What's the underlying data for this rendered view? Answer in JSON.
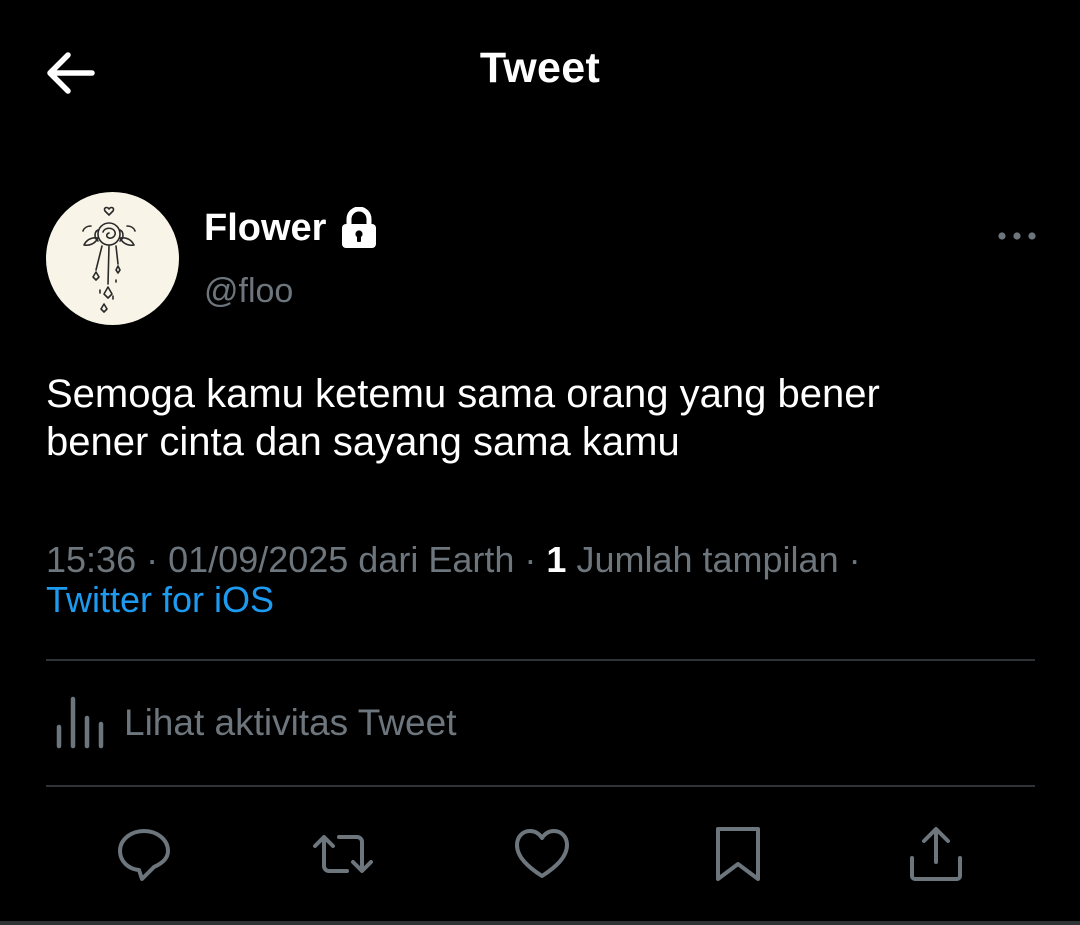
{
  "header": {
    "title": "Tweet",
    "back_icon": "arrow-left-icon"
  },
  "author": {
    "display_name": "Flower",
    "handle": "@floo",
    "protected_icon": "lock-icon",
    "avatar_icon": "rose-sketch-avatar"
  },
  "more_icon": "ellipsis-icon",
  "tweet": {
    "text_line1": "Semoga kamu ketemu sama orang yang bener",
    "text_line2": "bener cinta dan sayang sama kamu",
    "time": "15:36",
    "separator": "·",
    "date_location": "01/09/2025 dari Earth",
    "views_count": "1",
    "views_label": "Jumlah tampilan",
    "source": "Twitter for iOS"
  },
  "activity": {
    "label": "Lihat aktivitas Tweet",
    "icon": "bar-chart-icon"
  },
  "actions": [
    {
      "icon": "reply-icon"
    },
    {
      "icon": "retweet-icon"
    },
    {
      "icon": "like-icon"
    },
    {
      "icon": "bookmark-icon"
    },
    {
      "icon": "share-icon"
    }
  ],
  "colors": {
    "background": "#000000",
    "text_primary": "#ffffff",
    "text_secondary": "#6e767d",
    "link": "#1d9bf0",
    "divider": "#2f3336",
    "avatar_bg": "#f8f5e8"
  }
}
